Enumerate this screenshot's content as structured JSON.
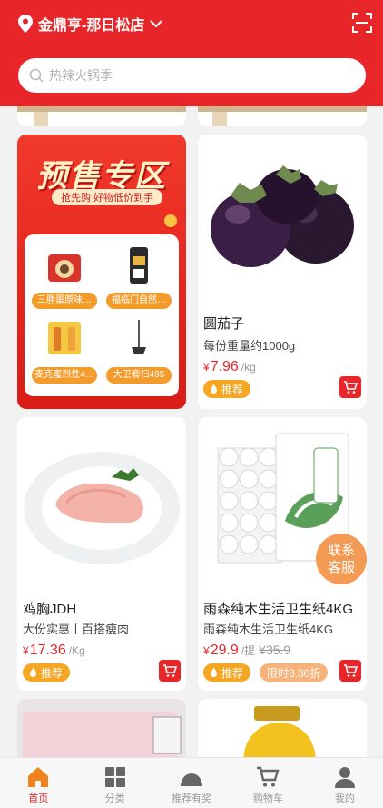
{
  "header": {
    "store_name": "金鼎亨-那日松店",
    "search_placeholder": "热辣火锅季"
  },
  "presale": {
    "title": "预售专区",
    "subtitle": "抢先购 好物低价到手",
    "items": [
      {
        "label": "三胖蛋原味…"
      },
      {
        "label": "福临门自然…"
      },
      {
        "label": "麦克蜜烈性4…"
      },
      {
        "label": "大卫套扫495"
      }
    ]
  },
  "products": [
    {
      "name": "圆茄子",
      "desc": "每份重量约1000g",
      "currency": "¥",
      "price": "7.96",
      "unit": "/kg",
      "tag": "推荐"
    },
    {
      "name": "鸡胸JDH",
      "desc": "大份实惠丨百搭瘦肉",
      "currency": "¥",
      "price": "17.36",
      "unit": "/Kg",
      "tag": "推荐"
    },
    {
      "name": "雨森纯木生活卫生纸4KG",
      "desc": "雨森纯木生活卫生纸4KG",
      "currency": "¥",
      "price": "29.9",
      "unit": "/提",
      "orig_price": "¥35.9",
      "tag": "推荐",
      "tag2": "限时8.30折"
    }
  ],
  "contact": {
    "line1": "联系",
    "line2": "客服"
  },
  "tabbar": {
    "items": [
      {
        "label": "首页",
        "icon": "home-icon",
        "active": true
      },
      {
        "label": "分类",
        "icon": "category-icon"
      },
      {
        "label": "推荐有奖",
        "icon": "reward-icon"
      },
      {
        "label": "购物车",
        "icon": "cart-icon"
      },
      {
        "label": "我的",
        "icon": "profile-icon"
      }
    ]
  },
  "colors": {
    "brand": "#e8262a",
    "tag": "#f5a623",
    "tab_inactive": "#999999"
  }
}
